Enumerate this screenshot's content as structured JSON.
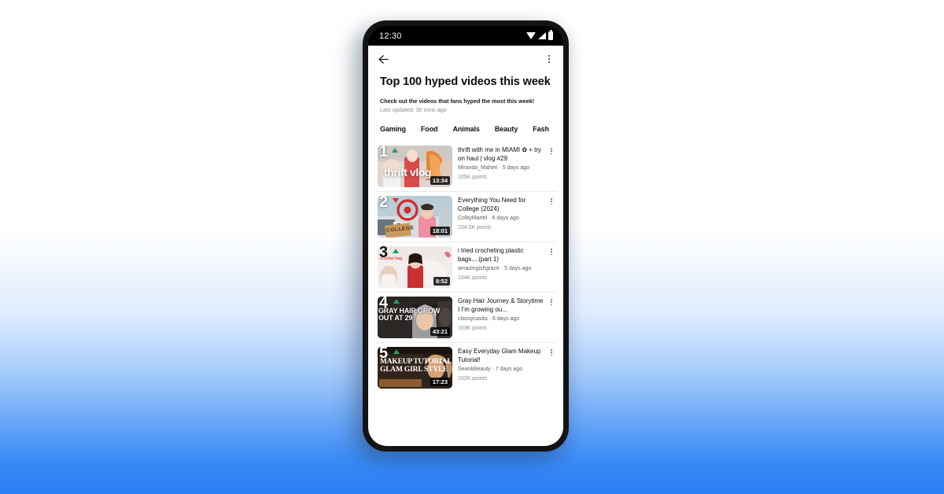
{
  "background": {
    "top_color": "#ffffff",
    "bottom_color": "#2a7ef4"
  },
  "phone": {
    "status_bar": {
      "time": "12:30",
      "icons": [
        "wifi-icon",
        "signal-icon",
        "battery-icon"
      ]
    },
    "app_bar": {
      "back_icon": "back-arrow-icon",
      "overflow_icon": "more-vertical-icon"
    },
    "header": {
      "title": "Top 100 hyped videos this week",
      "subtitle": "Check out the videos that fans hyped the most this week!",
      "last_updated": "Last updated: 30 mins ago"
    },
    "tabs": [
      {
        "label": "Gaming"
      },
      {
        "label": "Food"
      },
      {
        "label": "Animals"
      },
      {
        "label": "Beauty"
      },
      {
        "label": "Fash"
      }
    ],
    "videos": [
      {
        "rank": "1",
        "trend": "up",
        "duration": "13:34",
        "title": "thrift with me in MIAMI ✿ + try on haul | vlog #29",
        "channel": "Miranda_Maheri · 5 days ago",
        "points": "105K points",
        "thumb_text": "thrift vlog"
      },
      {
        "rank": "2",
        "trend": "down",
        "duration": "18:01",
        "title": "Everything You Need for College (2024)",
        "channel": "ColbyMartel · 6 days ago",
        "points": "104.5K points",
        "thumb_text": "COLLEGE"
      },
      {
        "rank": "3",
        "trend": "up",
        "duration": "8:52",
        "title": "i tried crocheting plastic bags....(part 1)",
        "channel": "amazingishgrace · 5 days ago",
        "points": "104K points",
        "thumb_text": "crochet bag"
      },
      {
        "rank": "4",
        "trend": "up",
        "duration": "43:21",
        "title": "Gray Hair Journey & Storytime I I'm growing ou...",
        "channel": "classycasita · 6 days ago",
        "points": "103K points",
        "thumb_text": "GRAY HAIR GROW OUT AT 29"
      },
      {
        "rank": "5",
        "trend": "up",
        "duration": "17:23",
        "title": "Easy Everyday Glam Makeup Tutorial!",
        "channel": "SeankBeauty · 7 days ago",
        "points": "102K points",
        "thumb_text": "MAKEUP TUTORIAL GLAM GIRL STYLE"
      }
    ]
  }
}
